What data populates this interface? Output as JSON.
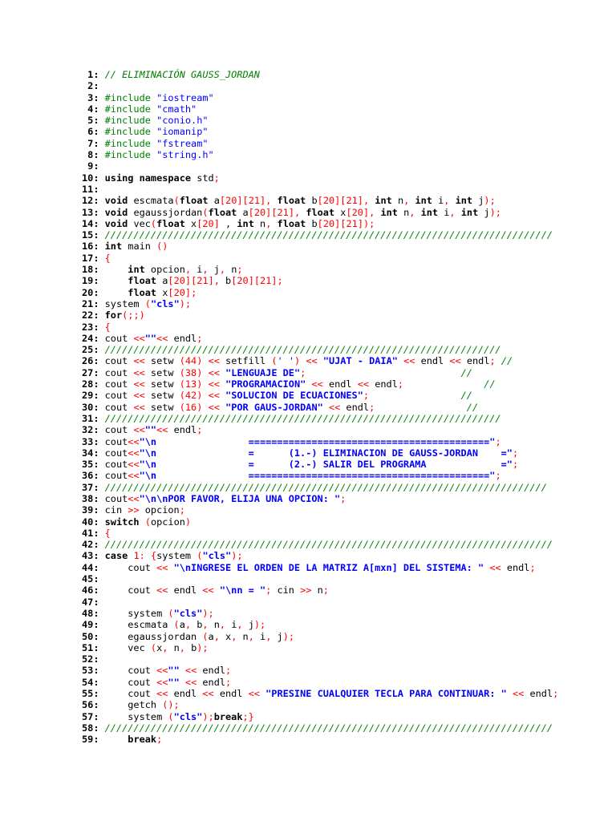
{
  "lines": [
    [
      [
        "// ELIMINACIÓN GAUSS_JORDAN",
        "cm"
      ]
    ],
    [],
    [
      [
        "#include ",
        "dir"
      ],
      [
        "\"iostream\"",
        "str"
      ]
    ],
    [
      [
        "#include ",
        "dir"
      ],
      [
        "\"cmath\"",
        "str"
      ]
    ],
    [
      [
        "#include ",
        "dir"
      ],
      [
        "\"conio.h\"",
        "str"
      ]
    ],
    [
      [
        "#include ",
        "dir"
      ],
      [
        "\"iomanip\"",
        "str"
      ]
    ],
    [
      [
        "#include ",
        "dir"
      ],
      [
        "\"fstream\"",
        "str"
      ]
    ],
    [
      [
        "#include ",
        "dir"
      ],
      [
        "\"string.h\"",
        "str"
      ]
    ],
    [],
    [
      [
        "using namespace",
        "kw"
      ],
      [
        " std",
        ""
      ],
      [
        ";",
        "op"
      ]
    ],
    [],
    [
      [
        "void",
        "kw"
      ],
      [
        " escmata",
        ""
      ],
      [
        "(",
        "op"
      ],
      [
        "float",
        "kw"
      ],
      [
        " a",
        ""
      ],
      [
        "[",
        "op"
      ],
      [
        "20",
        "num"
      ],
      [
        "][",
        "op"
      ],
      [
        "21",
        "num"
      ],
      [
        "],",
        "op"
      ],
      [
        " ",
        ""
      ],
      [
        "float",
        "kw"
      ],
      [
        " b",
        ""
      ],
      [
        "[",
        "op"
      ],
      [
        "20",
        "num"
      ],
      [
        "][",
        "op"
      ],
      [
        "21",
        "num"
      ],
      [
        "],",
        "op"
      ],
      [
        " ",
        ""
      ],
      [
        "int",
        "kw"
      ],
      [
        " n",
        ""
      ],
      [
        ",",
        "op"
      ],
      [
        " ",
        ""
      ],
      [
        "int",
        "kw"
      ],
      [
        " i",
        ""
      ],
      [
        ",",
        "op"
      ],
      [
        " ",
        ""
      ],
      [
        "int",
        "kw"
      ],
      [
        " j",
        ""
      ],
      [
        ");",
        "op"
      ]
    ],
    [
      [
        "void",
        "kw"
      ],
      [
        " egaussjordan",
        ""
      ],
      [
        "(",
        "op"
      ],
      [
        "float",
        "kw"
      ],
      [
        " a",
        ""
      ],
      [
        "[",
        "op"
      ],
      [
        "20",
        "num"
      ],
      [
        "][",
        "op"
      ],
      [
        "21",
        "num"
      ],
      [
        "],",
        "op"
      ],
      [
        " ",
        ""
      ],
      [
        "float",
        "kw"
      ],
      [
        " x",
        ""
      ],
      [
        "[",
        "op"
      ],
      [
        "20",
        "num"
      ],
      [
        "],",
        "op"
      ],
      [
        " ",
        ""
      ],
      [
        "int",
        "kw"
      ],
      [
        " n",
        ""
      ],
      [
        ",",
        "op"
      ],
      [
        " ",
        ""
      ],
      [
        "int",
        "kw"
      ],
      [
        " i",
        ""
      ],
      [
        ",",
        "op"
      ],
      [
        " ",
        ""
      ],
      [
        "int",
        "kw"
      ],
      [
        " j",
        ""
      ],
      [
        ");",
        "op"
      ]
    ],
    [
      [
        "void",
        "kw"
      ],
      [
        " vec",
        ""
      ],
      [
        "(",
        "op"
      ],
      [
        "float",
        "kw"
      ],
      [
        " x",
        ""
      ],
      [
        "[",
        "op"
      ],
      [
        "20",
        "num"
      ],
      [
        "]",
        "op"
      ],
      [
        " , ",
        ""
      ],
      [
        "int",
        "kw"
      ],
      [
        " n",
        ""
      ],
      [
        ",",
        "op"
      ],
      [
        " ",
        ""
      ],
      [
        "float",
        "kw"
      ],
      [
        " b",
        ""
      ],
      [
        "[",
        "op"
      ],
      [
        "20",
        "num"
      ],
      [
        "][",
        "op"
      ],
      [
        "21",
        "num"
      ],
      [
        "]);",
        "op"
      ]
    ],
    [
      [
        "//////////////////////////////////////////////////////////////////////////////",
        "cm"
      ]
    ],
    [
      [
        "int",
        "kw"
      ],
      [
        " main ",
        ""
      ],
      [
        "()",
        "op"
      ]
    ],
    [
      [
        "{",
        "op"
      ]
    ],
    [
      [
        "    ",
        ""
      ],
      [
        "int",
        "kw"
      ],
      [
        " opcion",
        ""
      ],
      [
        ",",
        "op"
      ],
      [
        " i",
        ""
      ],
      [
        ",",
        "op"
      ],
      [
        " j",
        ""
      ],
      [
        ",",
        "op"
      ],
      [
        " n",
        ""
      ],
      [
        ";",
        "op"
      ]
    ],
    [
      [
        "    ",
        ""
      ],
      [
        "float",
        "kw"
      ],
      [
        " a",
        ""
      ],
      [
        "[",
        "op"
      ],
      [
        "20",
        "num"
      ],
      [
        "][",
        "op"
      ],
      [
        "21",
        "num"
      ],
      [
        "],",
        "op"
      ],
      [
        " b",
        ""
      ],
      [
        "[",
        "op"
      ],
      [
        "20",
        "num"
      ],
      [
        "][",
        "op"
      ],
      [
        "21",
        "num"
      ],
      [
        "];",
        "op"
      ]
    ],
    [
      [
        "    ",
        ""
      ],
      [
        "float",
        "kw"
      ],
      [
        " x",
        ""
      ],
      [
        "[",
        "op"
      ],
      [
        "20",
        "num"
      ],
      [
        "];",
        "op"
      ]
    ],
    [
      [
        "system ",
        ""
      ],
      [
        "(",
        "op"
      ],
      [
        "\"cls\"",
        "bstr"
      ],
      [
        ");",
        "op"
      ]
    ],
    [
      [
        "for",
        "kw"
      ],
      [
        "(;;)",
        "op"
      ]
    ],
    [
      [
        "{",
        "op"
      ]
    ],
    [
      [
        "cout ",
        ""
      ],
      [
        "<<",
        "op"
      ],
      [
        "\"\"",
        "bstr"
      ],
      [
        "<<",
        "op"
      ],
      [
        " endl",
        ""
      ],
      [
        ";",
        "op"
      ]
    ],
    [
      [
        "/////////////////////////////////////////////////////////////////////",
        "cm"
      ]
    ],
    [
      [
        "cout ",
        ""
      ],
      [
        "<<",
        "op"
      ],
      [
        " setw ",
        ""
      ],
      [
        "(",
        "op"
      ],
      [
        "44",
        "num"
      ],
      [
        ")",
        "op"
      ],
      [
        " ",
        ""
      ],
      [
        "<<",
        "op"
      ],
      [
        " setfill ",
        ""
      ],
      [
        "(",
        "op"
      ],
      [
        "' '",
        "str"
      ],
      [
        ")",
        "op"
      ],
      [
        " ",
        ""
      ],
      [
        "<<",
        "op"
      ],
      [
        " ",
        ""
      ],
      [
        "\"UJAT - DAIA\"",
        "bstr"
      ],
      [
        " ",
        ""
      ],
      [
        "<<",
        "op"
      ],
      [
        " endl ",
        ""
      ],
      [
        "<<",
        "op"
      ],
      [
        " endl",
        ""
      ],
      [
        ";",
        "op"
      ],
      [
        " ",
        ""
      ],
      [
        "//",
        "cm"
      ]
    ],
    [
      [
        "cout ",
        ""
      ],
      [
        "<<",
        "op"
      ],
      [
        " setw ",
        ""
      ],
      [
        "(",
        "op"
      ],
      [
        "38",
        "num"
      ],
      [
        ")",
        "op"
      ],
      [
        " ",
        ""
      ],
      [
        "<<",
        "op"
      ],
      [
        " ",
        ""
      ],
      [
        "\"LENGUAJE DE\"",
        "bstr"
      ],
      [
        ";",
        "op"
      ],
      [
        "                           ",
        ""
      ],
      [
        "//",
        "cm"
      ]
    ],
    [
      [
        "cout ",
        ""
      ],
      [
        "<<",
        "op"
      ],
      [
        " setw ",
        ""
      ],
      [
        "(",
        "op"
      ],
      [
        "13",
        "num"
      ],
      [
        ")",
        "op"
      ],
      [
        " ",
        ""
      ],
      [
        "<<",
        "op"
      ],
      [
        " ",
        ""
      ],
      [
        "\"PROGRAMACION\"",
        "bstr"
      ],
      [
        " ",
        ""
      ],
      [
        "<<",
        "op"
      ],
      [
        " endl ",
        ""
      ],
      [
        "<<",
        "op"
      ],
      [
        " endl",
        ""
      ],
      [
        ";",
        "op"
      ],
      [
        "              ",
        ""
      ],
      [
        "//",
        "cm"
      ]
    ],
    [
      [
        "cout ",
        ""
      ],
      [
        "<<",
        "op"
      ],
      [
        " setw ",
        ""
      ],
      [
        "(",
        "op"
      ],
      [
        "42",
        "num"
      ],
      [
        ")",
        "op"
      ],
      [
        " ",
        ""
      ],
      [
        "<<",
        "op"
      ],
      [
        " ",
        ""
      ],
      [
        "\"SOLUCION DE ECUACIONES\"",
        "bstr"
      ],
      [
        ";",
        "op"
      ],
      [
        "                ",
        ""
      ],
      [
        "//",
        "cm"
      ]
    ],
    [
      [
        "cout ",
        ""
      ],
      [
        "<<",
        "op"
      ],
      [
        " setw ",
        ""
      ],
      [
        "(",
        "op"
      ],
      [
        "16",
        "num"
      ],
      [
        ")",
        "op"
      ],
      [
        " ",
        ""
      ],
      [
        "<<",
        "op"
      ],
      [
        " ",
        ""
      ],
      [
        "\"POR GAUS-JORDAN\"",
        "bstr"
      ],
      [
        " ",
        ""
      ],
      [
        "<<",
        "op"
      ],
      [
        " endl",
        ""
      ],
      [
        ";",
        "op"
      ],
      [
        "                ",
        ""
      ],
      [
        "//",
        "cm"
      ]
    ],
    [
      [
        "/////////////////////////////////////////////////////////////////////",
        "cm"
      ]
    ],
    [
      [
        "cout ",
        ""
      ],
      [
        "<<",
        "op"
      ],
      [
        "\"\"",
        "bstr"
      ],
      [
        "<<",
        "op"
      ],
      [
        " endl",
        ""
      ],
      [
        ";",
        "op"
      ]
    ],
    [
      [
        "cout",
        ""
      ],
      [
        "<<",
        "op"
      ],
      [
        "\"\\n                ==========================================\"",
        "bstr"
      ],
      [
        ";",
        "op"
      ]
    ],
    [
      [
        "cout",
        ""
      ],
      [
        "<<",
        "op"
      ],
      [
        "\"\\n                =      (1.-) ELIMINACION DE GAUSS-JORDAN    =\"",
        "bstr"
      ],
      [
        ";",
        "op"
      ]
    ],
    [
      [
        "cout",
        ""
      ],
      [
        "<<",
        "op"
      ],
      [
        "\"\\n                =      (2.-) SALIR DEL PROGRAMA             =\"",
        "bstr"
      ],
      [
        ";",
        "op"
      ]
    ],
    [
      [
        "cout",
        ""
      ],
      [
        "<<",
        "op"
      ],
      [
        "\"\\n                ==========================================\"",
        "bstr"
      ],
      [
        ";",
        "op"
      ]
    ],
    [
      [
        "/////////////////////////////////////////////////////////////////////////////",
        "cm"
      ]
    ],
    [
      [
        "cout",
        ""
      ],
      [
        "<<",
        "op"
      ],
      [
        "\"\\n\\nPOR FAVOR, ELIJA UNA OPCION: \"",
        "bstr"
      ],
      [
        ";",
        "op"
      ]
    ],
    [
      [
        "cin ",
        ""
      ],
      [
        ">>",
        "op"
      ],
      [
        " opcion",
        ""
      ],
      [
        ";",
        "op"
      ]
    ],
    [
      [
        "switch",
        "kw"
      ],
      [
        " ",
        ""
      ],
      [
        "(",
        "op"
      ],
      [
        "opcion",
        ""
      ],
      [
        ")",
        "op"
      ]
    ],
    [
      [
        "{",
        "op"
      ]
    ],
    [
      [
        "//////////////////////////////////////////////////////////////////////////////",
        "cm"
      ]
    ],
    [
      [
        "case",
        "kw"
      ],
      [
        " ",
        ""
      ],
      [
        "1",
        "num"
      ],
      [
        ":",
        "op"
      ],
      [
        " ",
        ""
      ],
      [
        "{",
        "op"
      ],
      [
        "system ",
        ""
      ],
      [
        "(",
        "op"
      ],
      [
        "\"cls\"",
        "bstr"
      ],
      [
        ");",
        "op"
      ]
    ],
    [
      [
        "    cout ",
        ""
      ],
      [
        "<<",
        "op"
      ],
      [
        " ",
        ""
      ],
      [
        "\"\\nINGRESE EL ORDEN DE LA MATRIZ A[mxn] DEL SISTEMA: \"",
        "bstr"
      ],
      [
        " ",
        ""
      ],
      [
        "<<",
        "op"
      ],
      [
        " endl",
        ""
      ],
      [
        ";",
        "op"
      ]
    ],
    [],
    [
      [
        "    cout ",
        ""
      ],
      [
        "<<",
        "op"
      ],
      [
        " endl ",
        ""
      ],
      [
        "<<",
        "op"
      ],
      [
        " ",
        ""
      ],
      [
        "\"\\nn = \"",
        "bstr"
      ],
      [
        ";",
        "op"
      ],
      [
        " cin ",
        ""
      ],
      [
        ">>",
        "op"
      ],
      [
        " n",
        ""
      ],
      [
        ";",
        "op"
      ]
    ],
    [],
    [
      [
        "    system ",
        ""
      ],
      [
        "(",
        "op"
      ],
      [
        "\"cls\"",
        "bstr"
      ],
      [
        ");",
        "op"
      ]
    ],
    [
      [
        "    escmata ",
        ""
      ],
      [
        "(",
        "op"
      ],
      [
        "a",
        ""
      ],
      [
        ",",
        "op"
      ],
      [
        " b",
        ""
      ],
      [
        ",",
        "op"
      ],
      [
        " n",
        ""
      ],
      [
        ",",
        "op"
      ],
      [
        " i",
        ""
      ],
      [
        ",",
        "op"
      ],
      [
        " j",
        ""
      ],
      [
        ");",
        "op"
      ]
    ],
    [
      [
        "    egaussjordan ",
        ""
      ],
      [
        "(",
        "op"
      ],
      [
        "a",
        ""
      ],
      [
        ",",
        "op"
      ],
      [
        " x",
        ""
      ],
      [
        ",",
        "op"
      ],
      [
        " n",
        ""
      ],
      [
        ",",
        "op"
      ],
      [
        " i",
        ""
      ],
      [
        ",",
        "op"
      ],
      [
        " j",
        ""
      ],
      [
        ");",
        "op"
      ]
    ],
    [
      [
        "    vec ",
        ""
      ],
      [
        "(",
        "op"
      ],
      [
        "x",
        ""
      ],
      [
        ",",
        "op"
      ],
      [
        " n",
        ""
      ],
      [
        ",",
        "op"
      ],
      [
        " b",
        ""
      ],
      [
        ");",
        "op"
      ]
    ],
    [],
    [
      [
        "    cout ",
        ""
      ],
      [
        "<<",
        "op"
      ],
      [
        "\"\"",
        "bstr"
      ],
      [
        " ",
        ""
      ],
      [
        "<<",
        "op"
      ],
      [
        " endl",
        ""
      ],
      [
        ";",
        "op"
      ]
    ],
    [
      [
        "    cout ",
        ""
      ],
      [
        "<<",
        "op"
      ],
      [
        "\"\"",
        "bstr"
      ],
      [
        " ",
        ""
      ],
      [
        "<<",
        "op"
      ],
      [
        " endl",
        ""
      ],
      [
        ";",
        "op"
      ]
    ],
    [
      [
        "    cout ",
        ""
      ],
      [
        "<<",
        "op"
      ],
      [
        " endl ",
        ""
      ],
      [
        "<<",
        "op"
      ],
      [
        " endl ",
        ""
      ],
      [
        "<<",
        "op"
      ],
      [
        " ",
        ""
      ],
      [
        "\"PRESINE CUALQUIER TECLA PARA CONTINUAR: \"",
        "bstr"
      ],
      [
        " ",
        ""
      ],
      [
        "<<",
        "op"
      ],
      [
        " endl",
        ""
      ],
      [
        ";",
        "op"
      ]
    ],
    [
      [
        "    getch ",
        ""
      ],
      [
        "();",
        "op"
      ]
    ],
    [
      [
        "    system ",
        ""
      ],
      [
        "(",
        "op"
      ],
      [
        "\"cls\"",
        "bstr"
      ],
      [
        ");",
        "op"
      ],
      [
        "break",
        "kw"
      ],
      [
        ";}",
        "op"
      ]
    ],
    [
      [
        "//////////////////////////////////////////////////////////////////////////////",
        "cm"
      ]
    ],
    [
      [
        "    ",
        ""
      ],
      [
        "break",
        "kw"
      ],
      [
        ";",
        "op"
      ]
    ]
  ]
}
